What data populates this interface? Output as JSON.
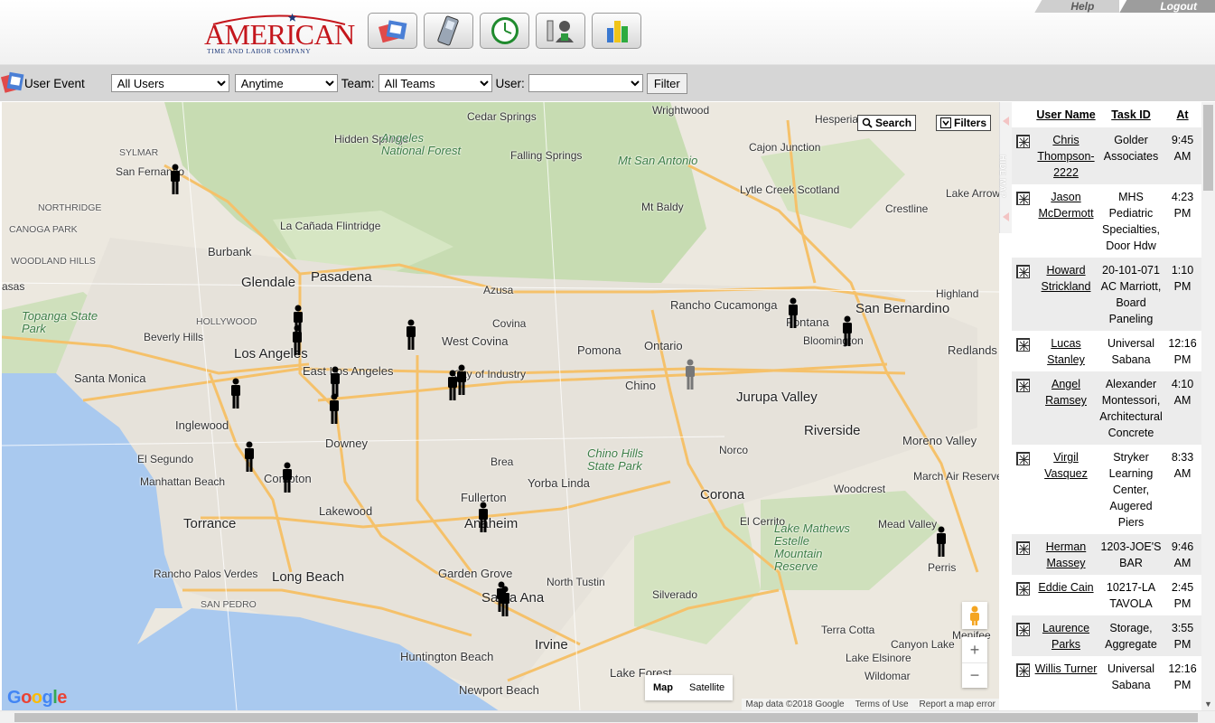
{
  "header": {
    "logo_main": "AMERICAN",
    "logo_sub": "TIME AND LABOR COMPANY",
    "nav": [
      {
        "name": "schedule-icon"
      },
      {
        "name": "mobile-phone-icon"
      },
      {
        "name": "clock-icon"
      },
      {
        "name": "user-admin-icon"
      },
      {
        "name": "reports-chart-icon"
      }
    ],
    "help_label": "Help",
    "logout_label": "Logout"
  },
  "filterbar": {
    "title": "User Event",
    "users_selected": "All Users",
    "time_selected": "Anytime",
    "team_label": "Team:",
    "team_selected": "All Teams",
    "user_label": "User:",
    "user_selected": "",
    "filter_label": "Filter"
  },
  "map": {
    "search_label": "Search",
    "filters_label": "Filters",
    "hide_label": "HIDE MAP",
    "map_label": "Map",
    "satellite_label": "Satellite",
    "attribution": [
      "Map data ©2018 Google",
      "Terms of Use",
      "Report a map error"
    ],
    "google": "Google",
    "labels": [
      {
        "t": "Wrightwood",
        "c": ""
      },
      {
        "t": "Cedar Springs",
        "c": ""
      },
      {
        "t": "Hidden Springs",
        "c": ""
      },
      {
        "t": "Angeles National Forest",
        "c": "park"
      },
      {
        "t": "Falling Springs",
        "c": ""
      },
      {
        "t": "Mt San Antonio",
        "c": "park"
      },
      {
        "t": "Hesperia",
        "c": ""
      },
      {
        "t": "Cajon Junction",
        "c": ""
      },
      {
        "t": "Lytle Creek Scotland",
        "c": ""
      },
      {
        "t": "Mt Baldy",
        "c": ""
      },
      {
        "t": "Crestline",
        "c": ""
      },
      {
        "t": "Lake Arrowhead",
        "c": ""
      },
      {
        "t": "SYLMAR",
        "c": "small"
      },
      {
        "t": "San Fernando",
        "c": ""
      },
      {
        "t": "NORTHRIDGE",
        "c": "small"
      },
      {
        "t": "CANOGA PARK",
        "c": "small"
      },
      {
        "t": "La Cañada Flintridge",
        "c": ""
      },
      {
        "t": "Burbank",
        "c": "med"
      },
      {
        "t": "WOODLAND HILLS",
        "c": "small"
      },
      {
        "t": "Glendale",
        "c": "big"
      },
      {
        "t": "Pasadena",
        "c": "big"
      },
      {
        "t": "Azusa",
        "c": ""
      },
      {
        "t": "Rancho Cucamonga",
        "c": "med"
      },
      {
        "t": "Highland",
        "c": ""
      },
      {
        "t": "San Bernardino",
        "c": "big"
      },
      {
        "t": "Fontana",
        "c": "med"
      },
      {
        "t": "Bloomington",
        "c": ""
      },
      {
        "t": "Topanga State Park",
        "c": "park"
      },
      {
        "t": "HOLLYWOOD",
        "c": "small"
      },
      {
        "t": "Beverly Hills",
        "c": ""
      },
      {
        "t": "Los Angeles",
        "c": "big"
      },
      {
        "t": "Covina",
        "c": ""
      },
      {
        "t": "West Covina",
        "c": "med"
      },
      {
        "t": "Pomona",
        "c": "med"
      },
      {
        "t": "Ontario",
        "c": "med"
      },
      {
        "t": "Redlands",
        "c": "med"
      },
      {
        "t": "Santa Monica",
        "c": "med"
      },
      {
        "t": "East Los Angeles",
        "c": "med"
      },
      {
        "t": "City of Industry",
        "c": ""
      },
      {
        "t": "Chino",
        "c": "med"
      },
      {
        "t": "Jurupa Valley",
        "c": "big"
      },
      {
        "t": "Inglewood",
        "c": "med"
      },
      {
        "t": "Downey",
        "c": "med"
      },
      {
        "t": "Riverside",
        "c": "big"
      },
      {
        "t": "Moreno Valley",
        "c": "med"
      },
      {
        "t": "Chino Hills State Park",
        "c": "park"
      },
      {
        "t": "Norco",
        "c": ""
      },
      {
        "t": "El Segundo",
        "c": ""
      },
      {
        "t": "Manhattan Beach",
        "c": ""
      },
      {
        "t": "Compton",
        "c": "med"
      },
      {
        "t": "Brea",
        "c": ""
      },
      {
        "t": "Yorba Linda",
        "c": "med"
      },
      {
        "t": "March Air Reserve Base",
        "c": ""
      },
      {
        "t": "Woodcrest",
        "c": ""
      },
      {
        "t": "Fullerton",
        "c": "med"
      },
      {
        "t": "Corona",
        "c": "big"
      },
      {
        "t": "Torrance",
        "c": "big"
      },
      {
        "t": "Lakewood",
        "c": "med"
      },
      {
        "t": "Anaheim",
        "c": "big"
      },
      {
        "t": "El Cerrito",
        "c": ""
      },
      {
        "t": "Lake Mathews Estelle Mountain Reserve",
        "c": "park"
      },
      {
        "t": "Mead Valley",
        "c": ""
      },
      {
        "t": "Perris",
        "c": ""
      },
      {
        "t": "Long Beach",
        "c": "big"
      },
      {
        "t": "Garden Grove",
        "c": "med"
      },
      {
        "t": "North Tustin",
        "c": ""
      },
      {
        "t": "Rancho Palos Verdes",
        "c": ""
      },
      {
        "t": "SAN PEDRO",
        "c": "small"
      },
      {
        "t": "Santa Ana",
        "c": "big"
      },
      {
        "t": "Silverado",
        "c": ""
      },
      {
        "t": "Terra Cotta",
        "c": ""
      },
      {
        "t": "Canyon Lake",
        "c": ""
      },
      {
        "t": "Menifee",
        "c": ""
      },
      {
        "t": "Irvine",
        "c": "big"
      },
      {
        "t": "Lake Elsinore",
        "c": ""
      },
      {
        "t": "Wildomar",
        "c": ""
      },
      {
        "t": "Huntington Beach",
        "c": "med"
      },
      {
        "t": "Lake Forest",
        "c": "med"
      },
      {
        "t": "Newport Beach",
        "c": "med"
      },
      {
        "t": "asas",
        "c": ""
      }
    ]
  },
  "table": {
    "headers": [
      "User Name",
      "Task ID",
      "At"
    ],
    "rows": [
      {
        "name": "Chris Thompson-2222",
        "task": "Golder Associates",
        "at": "9:45 AM"
      },
      {
        "name": "Jason McDermott",
        "task": "MHS Pediatric Specialties, Door Hdw",
        "at": "4:23 PM"
      },
      {
        "name": "Howard Strickland",
        "task": "20-101-071 AC Marriott, Board Paneling",
        "at": "1:10 PM"
      },
      {
        "name": "Lucas Stanley",
        "task": "Universal Sabana",
        "at": "12:16 PM"
      },
      {
        "name": "Angel Ramsey",
        "task": "Alexander Montessori, Architectural Concrete",
        "at": "4:10 AM"
      },
      {
        "name": "Virgil Vasquez",
        "task": "Stryker Learning Center, Augered Piers",
        "at": "8:33 AM"
      },
      {
        "name": "Herman Massey",
        "task": "1203-JOE'S BAR",
        "at": "9:46 AM"
      },
      {
        "name": "Eddie Cain",
        "task": "10217-LA TAVOLA",
        "at": "2:45 PM"
      },
      {
        "name": "Laurence Parks",
        "task": "Storage, Aggregate",
        "at": "3:55 PM"
      },
      {
        "name": "Willis Turner",
        "task": "Universal Sabana",
        "at": "12:16 PM"
      }
    ]
  },
  "colors": {
    "logo_red": "#c4161c",
    "logo_blue": "#1f3a7a",
    "filterbar_bg": "#d6d6d6"
  }
}
